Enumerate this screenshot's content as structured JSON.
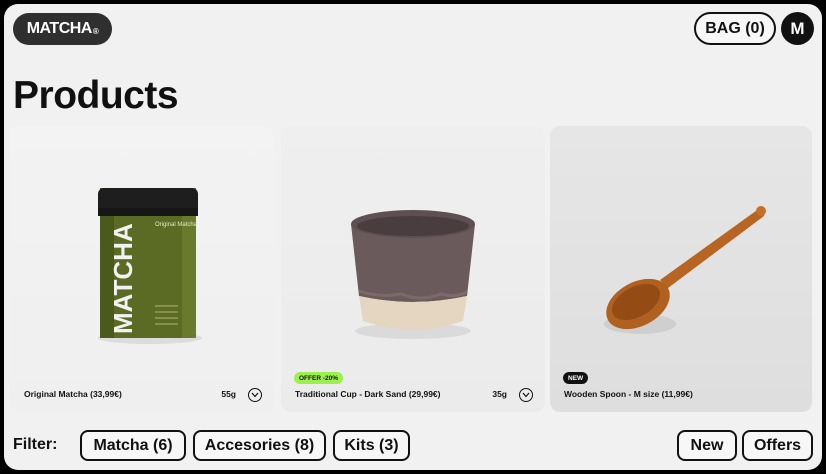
{
  "header": {
    "logo_text": "MATCHA",
    "logo_mark": "®",
    "bag_label": "BAG (0)",
    "avatar_initial": "M"
  },
  "page_title": "Products",
  "products": [
    {
      "name": "Original Matcha (33,99€)",
      "weight": "55g",
      "badge": "",
      "image": "matcha-tin"
    },
    {
      "name": "Traditional Cup - Dark Sand (29,99€)",
      "weight": "35g",
      "badge": "OFFER -20%",
      "image": "ceramic-cup"
    },
    {
      "name": "Wooden Spoon - M size (11,99€)",
      "weight": "",
      "badge": "NEW",
      "image": "wooden-spoon"
    }
  ],
  "tin_label": {
    "brand": "MATCHA",
    "caption": "Original Matcha"
  },
  "filters": {
    "label": "Filter:",
    "categories": [
      "Matcha (6)",
      "Accesories (8)",
      "Kits (3)"
    ],
    "tags": [
      "New",
      "Offers"
    ]
  },
  "colors": {
    "offer_badge": "#9cf04b",
    "tin_green": "#5b6b24",
    "dark": "#111111"
  }
}
